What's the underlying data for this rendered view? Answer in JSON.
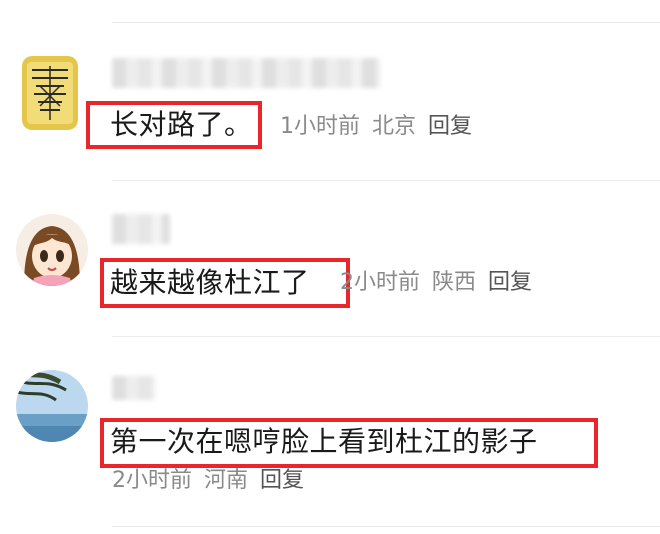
{
  "comments": [
    {
      "text": "长对路了。",
      "time": "1小时前",
      "location": "北京",
      "reply": "回复"
    },
    {
      "text": "越来越像杜江了",
      "time": "2小时前",
      "location": "陕西",
      "reply": "回复"
    },
    {
      "text": "第一次在嗯哼脸上看到杜江的影子",
      "time": "2小时前",
      "location": "河南",
      "reply": "回复"
    }
  ],
  "colors": {
    "highlight": "#e8262b",
    "meta_text": "#8a8a8a",
    "comment_text": "#1a1a1a"
  }
}
